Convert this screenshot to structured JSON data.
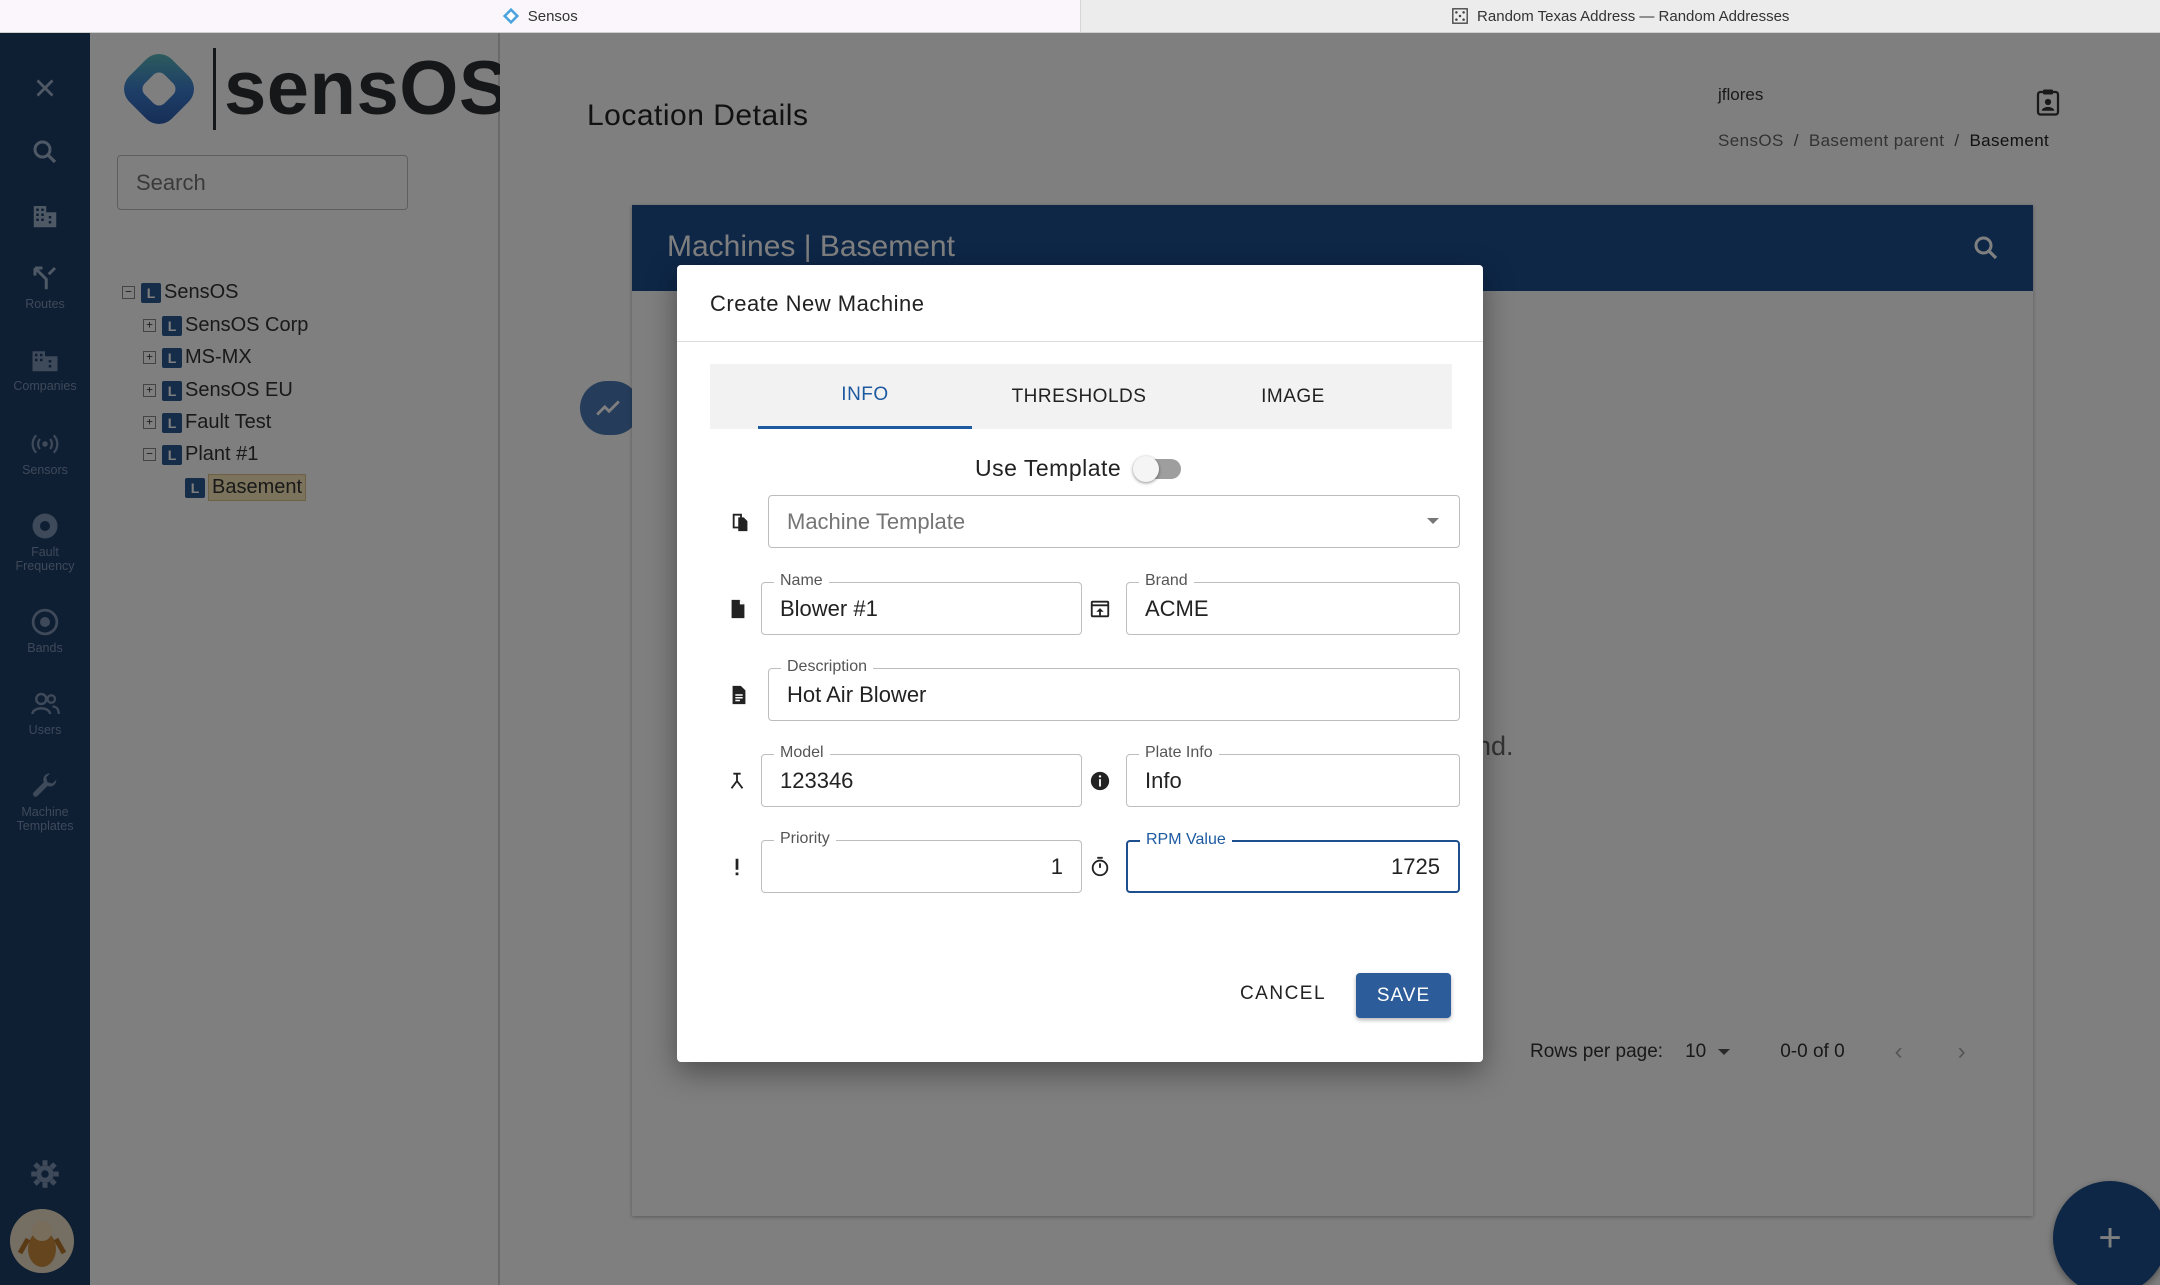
{
  "browser": {
    "tabs": [
      {
        "label": "Sensos",
        "active": true
      },
      {
        "label": "Random Texas Address — Random Addresses",
        "active": false
      }
    ]
  },
  "rail": {
    "items": [
      {
        "label": "Routes",
        "icon": "routes-icon"
      },
      {
        "label": "Companies",
        "icon": "companies-icon"
      },
      {
        "label": "Sensors",
        "icon": "sensors-icon"
      },
      {
        "label": "Fault Frequency",
        "icon": "fault-frequency-icon"
      },
      {
        "label": "Bands",
        "icon": "bands-icon"
      },
      {
        "label": "Users",
        "icon": "users-icon"
      },
      {
        "label": "Machine Templates",
        "icon": "wrench-icon"
      }
    ]
  },
  "tree": {
    "logo_text": "sensOS",
    "search_placeholder": "Search",
    "nodes": [
      {
        "label": "SensOS",
        "expander": "−"
      },
      {
        "label": "SensOS Corp",
        "expander": "+"
      },
      {
        "label": "MS-MX",
        "expander": "+"
      },
      {
        "label": "SensOS EU",
        "expander": "+"
      },
      {
        "label": "Fault Test",
        "expander": "+"
      },
      {
        "label": "Plant #1",
        "expander": "−"
      },
      {
        "label": "Basement",
        "expander": ""
      }
    ],
    "selected": "Basement"
  },
  "header": {
    "title": "Location Details",
    "user": "jflores",
    "breadcrumbs": [
      "SensOS",
      "Basement parent",
      "Basement"
    ]
  },
  "card": {
    "title": "Machines | Basement",
    "empty_text": "ind.",
    "rows_per_page_label": "Rows per page:",
    "rows_per_page": "10",
    "range": "0-0 of 0"
  },
  "dialog": {
    "title": "Create New Machine",
    "tabs": [
      "INFO",
      "THRESHOLDS",
      "IMAGE"
    ],
    "active_tab": "INFO",
    "use_template_label": "Use Template",
    "use_template_on": false,
    "machine_template_placeholder": "Machine Template",
    "fields": {
      "name": {
        "label": "Name",
        "value": "Blower #1"
      },
      "brand": {
        "label": "Brand",
        "value": "ACME"
      },
      "description": {
        "label": "Description",
        "value": "Hot Air Blower"
      },
      "model": {
        "label": "Model",
        "value": "123346"
      },
      "plate_info": {
        "label": "Plate Info",
        "value": "Info"
      },
      "priority": {
        "label": "Priority",
        "value": "1"
      },
      "rpm": {
        "label": "RPM Value",
        "value": "1725"
      }
    },
    "cancel_label": "CANCEL",
    "save_label": "SAVE"
  },
  "colors": {
    "rail": "#1c3d66",
    "primary": "#1d4f8e",
    "accent": "#2c5c9a"
  }
}
